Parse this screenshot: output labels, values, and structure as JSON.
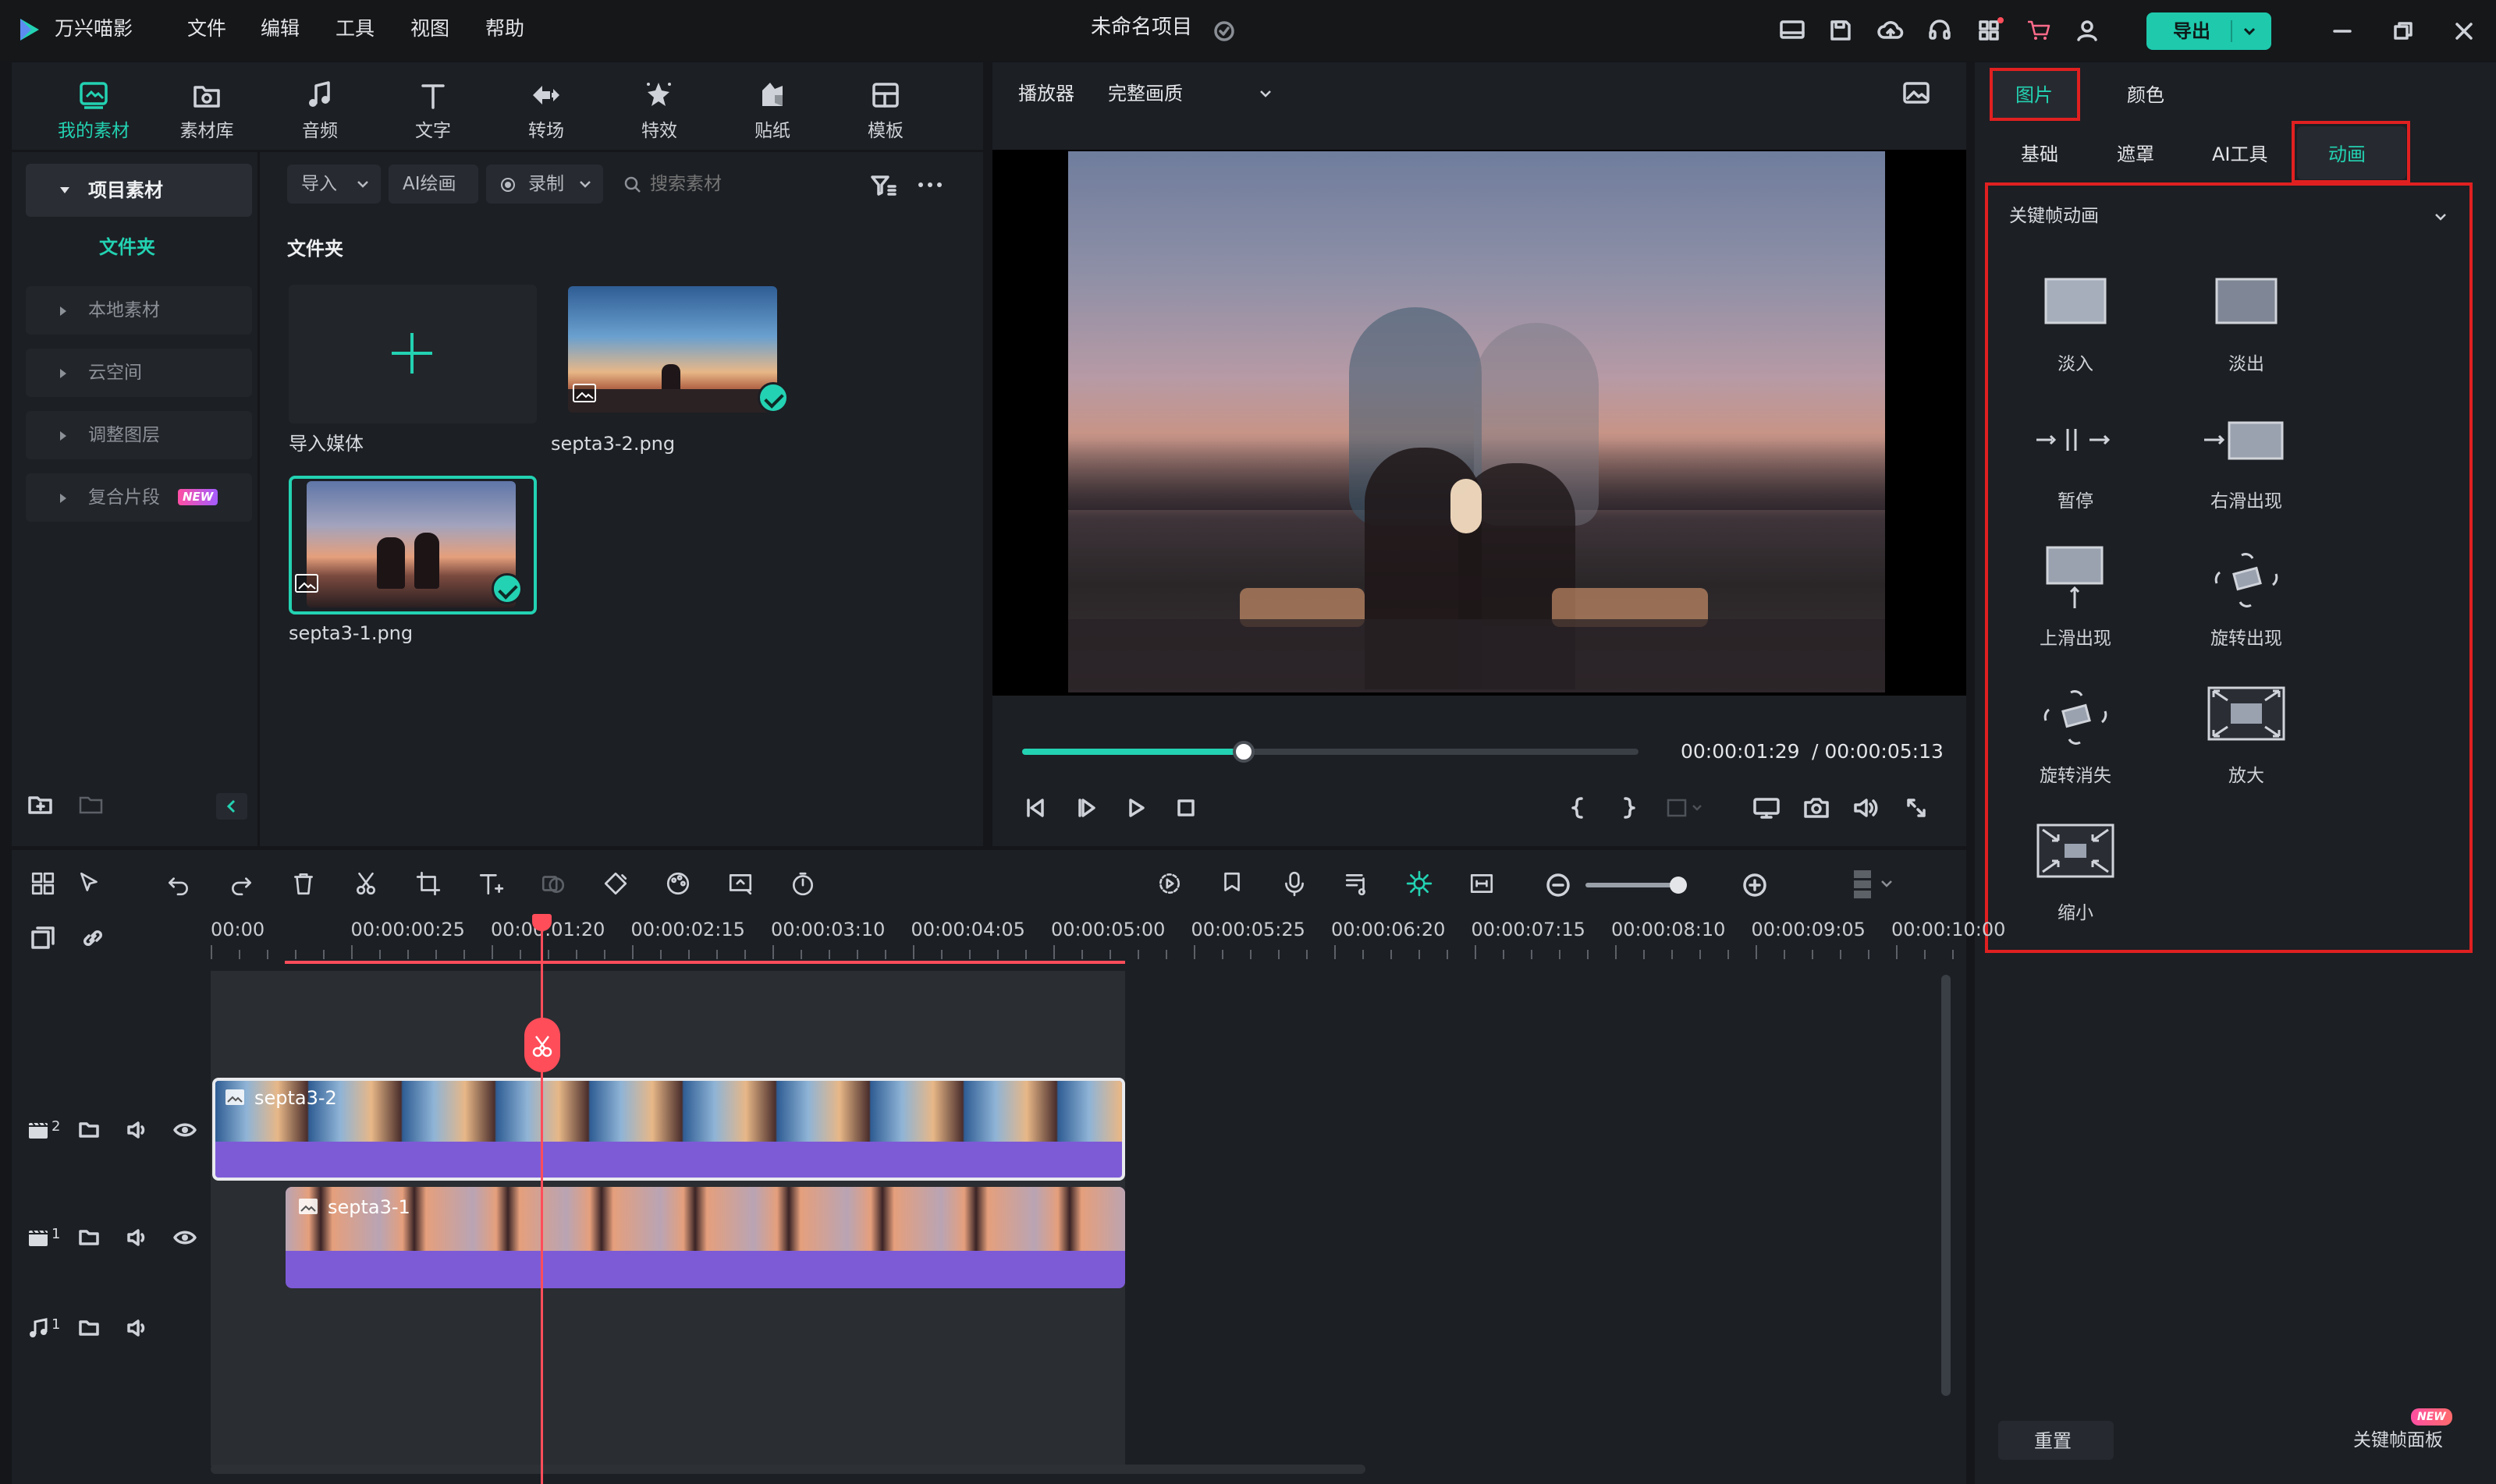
{
  "app": {
    "name": "万兴喵影",
    "project_title": "未命名项目",
    "menu": [
      "文件",
      "编辑",
      "工具",
      "视图",
      "帮助"
    ],
    "export_label": "导出"
  },
  "toolbar": {
    "items": [
      {
        "label": "我的素材",
        "icon": "my-media-icon",
        "active": true
      },
      {
        "label": "素材库",
        "icon": "stock-library-icon"
      },
      {
        "label": "音频",
        "icon": "music-note-icon"
      },
      {
        "label": "文字",
        "icon": "text-t-icon"
      },
      {
        "label": "转场",
        "icon": "transition-icon"
      },
      {
        "label": "特效",
        "icon": "effects-sparkle-icon"
      },
      {
        "label": "贴纸",
        "icon": "sticker-icon"
      },
      {
        "label": "模板",
        "icon": "template-icon"
      }
    ]
  },
  "library": {
    "section_title": "项目素材",
    "folder_label": "文件夹",
    "side_items": [
      {
        "label": "本地素材"
      },
      {
        "label": "云空间"
      },
      {
        "label": "调整图层"
      },
      {
        "label": "复合片段",
        "badge": "NEW"
      }
    ],
    "import_label": "导入",
    "ai_draw_label": "AI绘画",
    "record_label": "录制",
    "search_placeholder": "搜索素材",
    "folder_heading": "文件夹",
    "import_media_label": "导入媒体",
    "media": [
      {
        "name": "septa3-2.png",
        "selected": false
      },
      {
        "name": "septa3-1.png",
        "selected": true
      }
    ]
  },
  "preview": {
    "player_label": "播放器",
    "quality_label": "完整画质",
    "current_time": "00:00:01:29",
    "total_time": "/ 00:00:05:13",
    "progress_fraction": 0.36
  },
  "right_panel": {
    "tabs": [
      {
        "label": "图片",
        "active": true
      },
      {
        "label": "颜色"
      }
    ],
    "subtabs": [
      {
        "label": "基础"
      },
      {
        "label": "遮罩"
      },
      {
        "label": "AI工具"
      },
      {
        "label": "动画",
        "active": true
      }
    ],
    "section_title": "关键帧动画",
    "animations": [
      {
        "label": "淡入",
        "icon": "fade-in-icon"
      },
      {
        "label": "淡出",
        "icon": "fade-out-icon"
      },
      {
        "label": "暂停",
        "icon": "pause-anim-icon"
      },
      {
        "label": "右滑出现",
        "icon": "slide-right-icon"
      },
      {
        "label": "上滑出现",
        "icon": "slide-up-icon"
      },
      {
        "label": "旋转出现",
        "icon": "rotate-in-icon"
      },
      {
        "label": "旋转消失",
        "icon": "rotate-out-icon"
      },
      {
        "label": "放大",
        "icon": "zoom-in-icon"
      },
      {
        "label": "缩小",
        "icon": "zoom-out-icon"
      }
    ],
    "reset_label": "重置",
    "keyframe_panel_label": "关键帧面板",
    "keyframe_badge": "NEW"
  },
  "timeline": {
    "ruler_labels": [
      "00:00",
      "00:00:00:25",
      "00:00:01:20",
      "00:00:02:15",
      "00:00:03:10",
      "00:00:04:05",
      "00:00:05:00",
      "00:00:05:25",
      "00:00:06:20",
      "00:00:07:15",
      "00:00:08:10",
      "00:00:09:05",
      "00:00:10:00"
    ],
    "tracks": [
      {
        "kind": "video",
        "index": "2",
        "clip": "septa3-2"
      },
      {
        "kind": "video",
        "index": "1",
        "clip": "septa3-1"
      },
      {
        "kind": "audio",
        "index": "1"
      }
    ]
  },
  "colors": {
    "accent": "#23d2b2",
    "highlight": "#e02020",
    "playhead": "#ff4d5a",
    "clip_audio": "#7d5bd6"
  }
}
